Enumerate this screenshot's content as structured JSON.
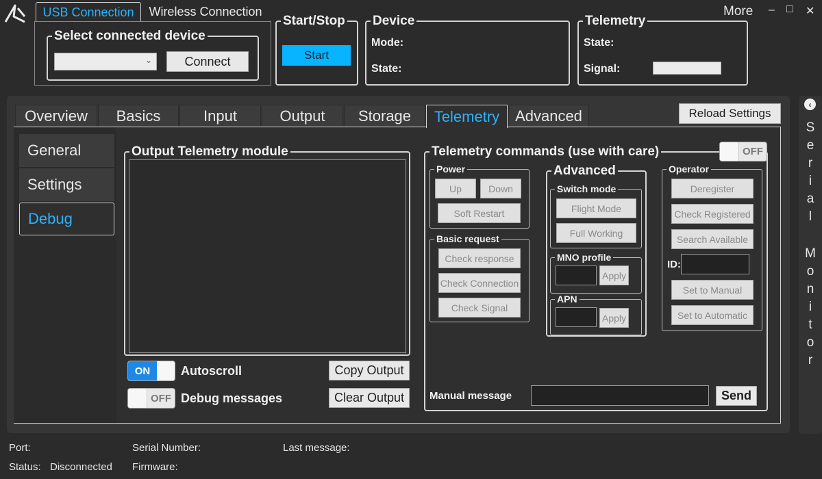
{
  "app": {
    "logo_icon": "app-logo-icon"
  },
  "window": {
    "more": "More",
    "minimize": "–",
    "maximize": "□",
    "close": "✕"
  },
  "conn_tabs": [
    "USB Connection",
    "Wireless Connection"
  ],
  "device_select": {
    "legend": "Select connected device",
    "value": "",
    "connect": "Connect"
  },
  "start_stop": {
    "legend": "Start/Stop",
    "button": "Start"
  },
  "device": {
    "legend": "Device",
    "mode_label": "Mode:",
    "state_label": "State:"
  },
  "telemetry_top": {
    "legend": "Telemetry",
    "state_label": "State:",
    "signal_label": "Signal:",
    "signal_level": 0
  },
  "main_tabs": [
    "Overview",
    "Basics",
    "Input",
    "Output",
    "Storage",
    "Telemetry",
    "Advanced"
  ],
  "reload": "Reload Settings",
  "side_tabs": [
    "General",
    "Settings",
    "Debug"
  ],
  "output": {
    "legend": "Output Telemetry module",
    "text": ""
  },
  "autoscroll": {
    "state": "ON",
    "label": "Autoscroll"
  },
  "debug_messages": {
    "state": "OFF",
    "label": "Debug messages"
  },
  "copy_output": "Copy Output",
  "clear_output": "Clear Output",
  "commands": {
    "legend": "Telemetry commands (use with care)",
    "toggle": "OFF",
    "power": {
      "legend": "Power",
      "up": "Up",
      "down": "Down",
      "soft_restart": "Soft Restart"
    },
    "basic": {
      "legend": "Basic request",
      "check_response": "Check response",
      "check_connection": "Check Connection",
      "check_signal": "Check Signal"
    },
    "advanced": {
      "legend": "Advanced",
      "switch_mode": {
        "legend": "Switch mode",
        "flight": "Flight Mode",
        "full": "Full Working"
      },
      "mno": {
        "legend": "MNO profile",
        "apply": "Apply"
      },
      "apn": {
        "legend": "APN",
        "apply": "Apply"
      }
    },
    "operator": {
      "legend": "Operator",
      "deregister": "Deregister",
      "check_registered": "Check Registered",
      "search_available": "Search Available",
      "id_label": "ID:",
      "set_manual": "Set to Manual",
      "set_auto": "Set to Automatic"
    },
    "manual_message": {
      "label": "Manual message",
      "value": "",
      "send": "Send"
    }
  },
  "serial_monitor": {
    "letters": [
      "S",
      "e",
      "r",
      "i",
      "a",
      "l",
      "",
      "M",
      "o",
      "n",
      "i",
      "t",
      "o",
      "r"
    ]
  },
  "statusbar": {
    "port_label": "Port:",
    "port_value": "",
    "status_label": "Status:",
    "status_value": "Disconnected",
    "serial_label": "Serial Number:",
    "serial_value": "",
    "firmware_label": "Firmware:",
    "firmware_value": "",
    "last_label": "Last message:",
    "last_value": ""
  }
}
